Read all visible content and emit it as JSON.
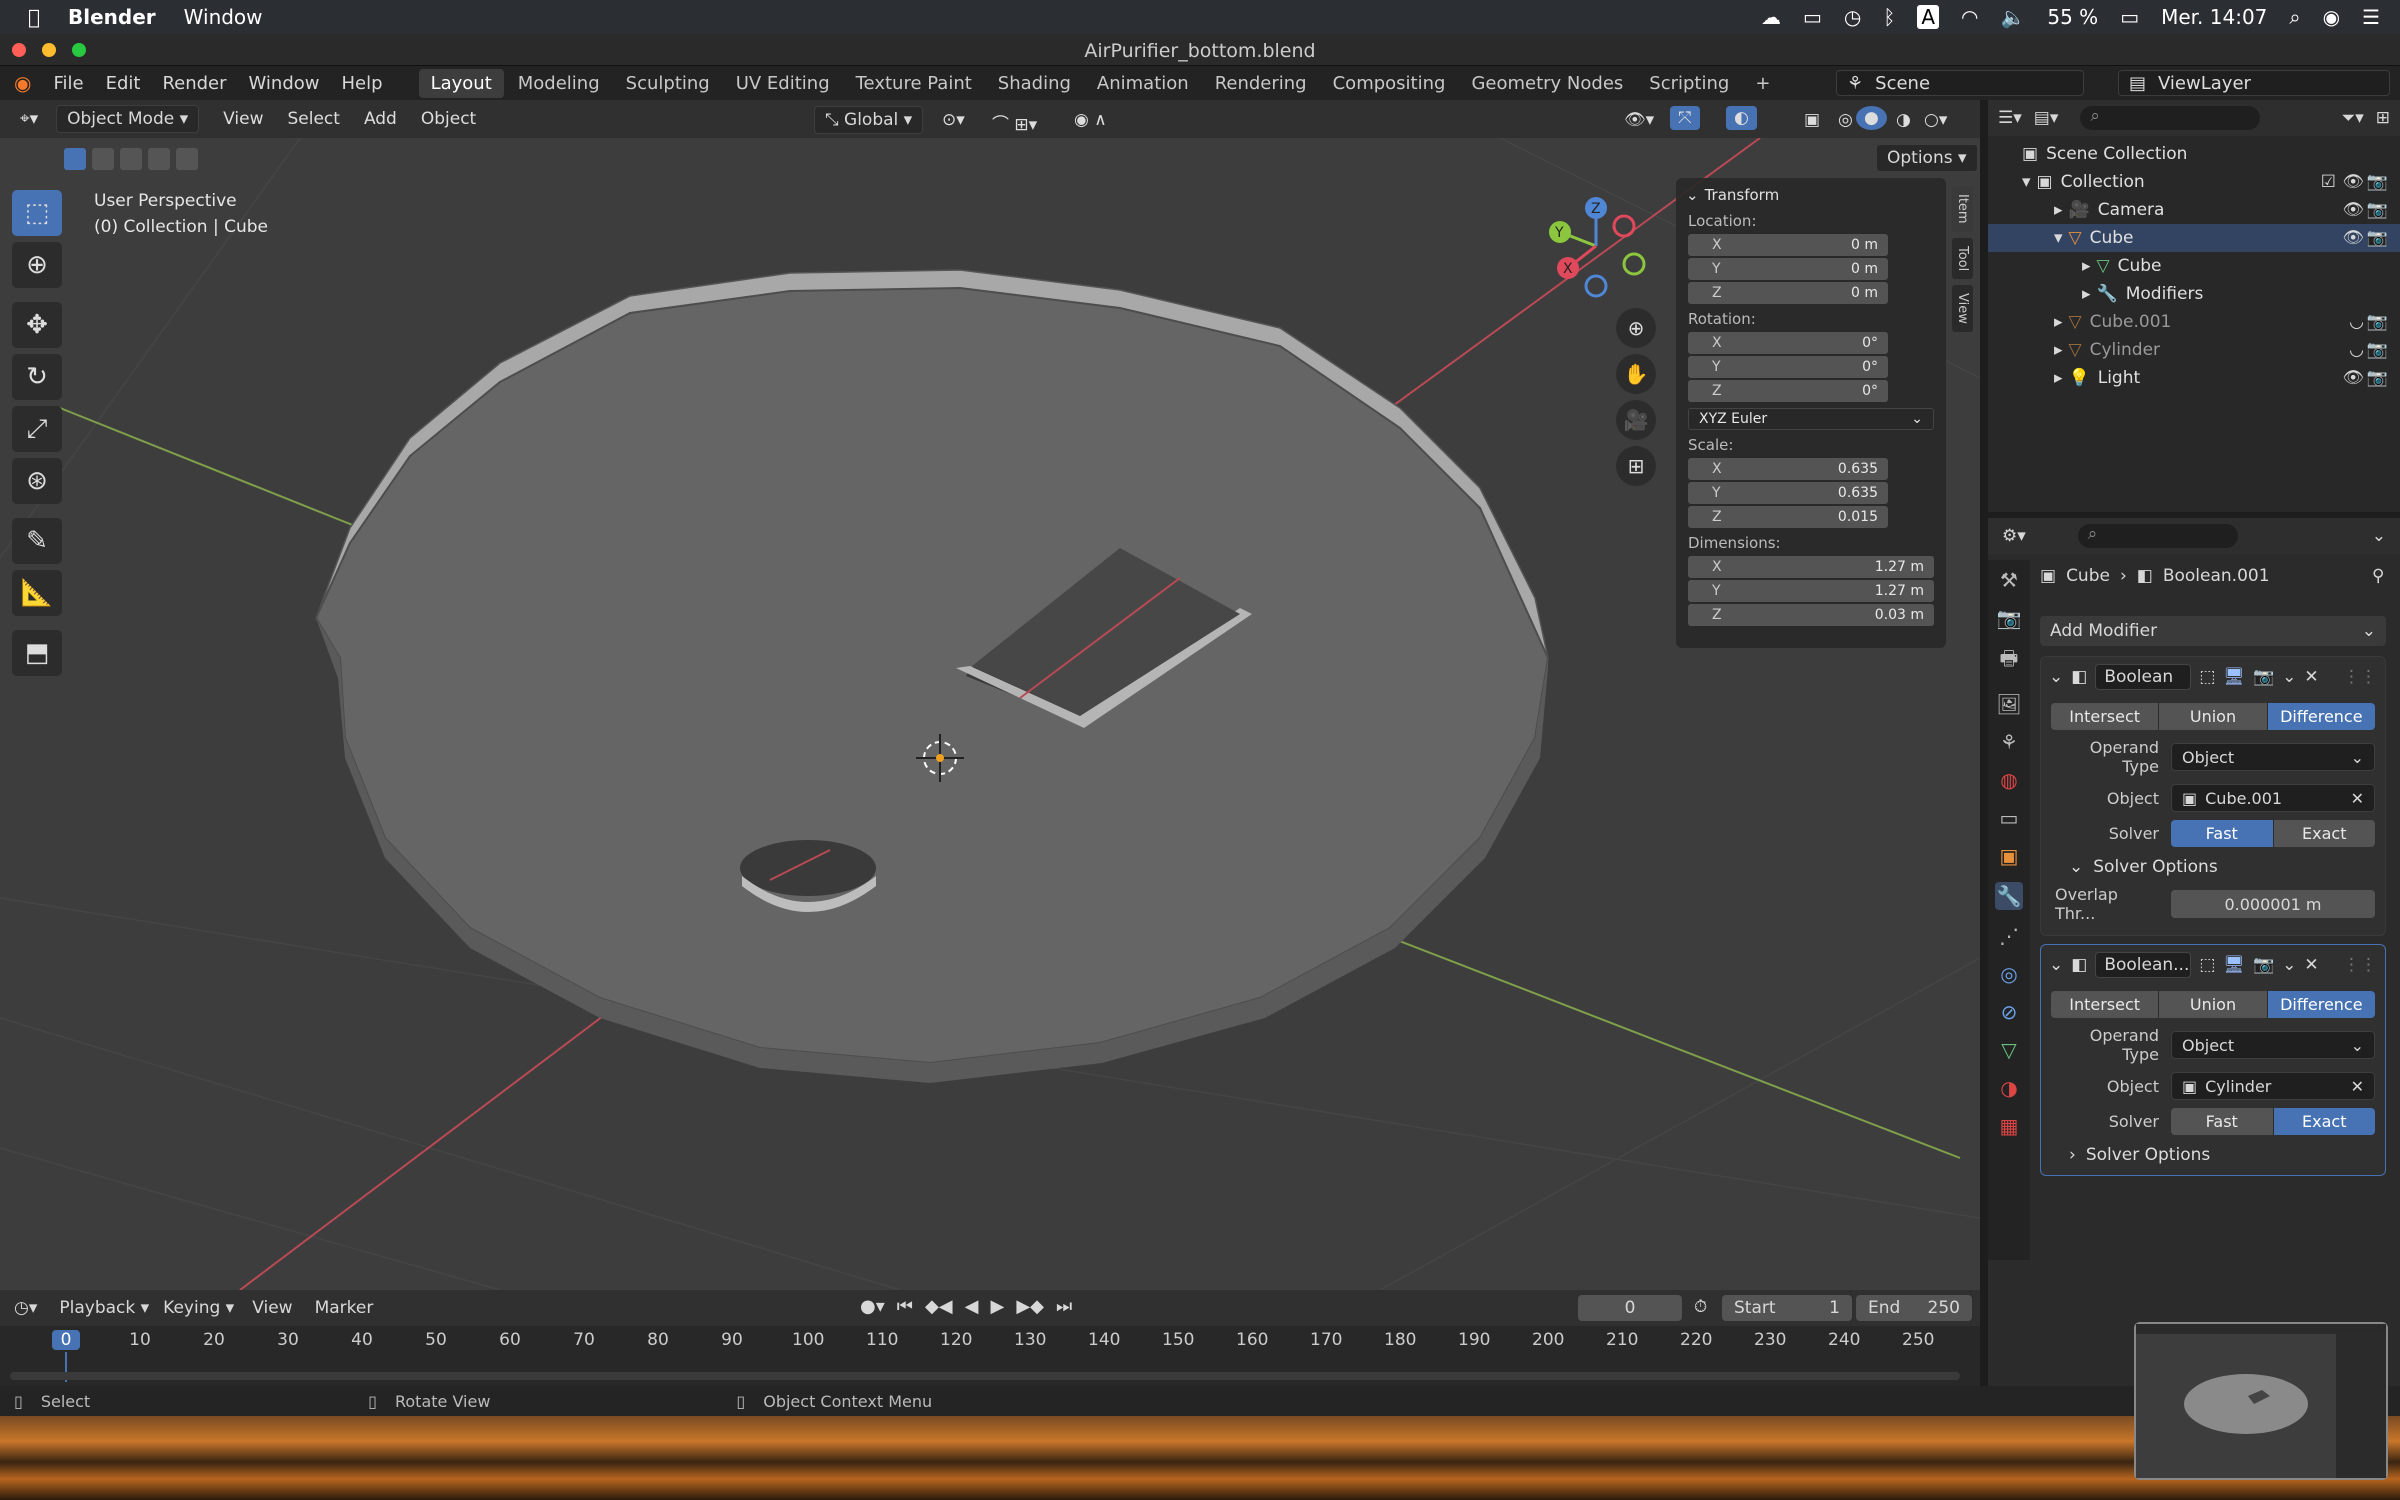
{
  "macos": {
    "app_name": "Blender",
    "menu_window": "Window",
    "battery": "55 %",
    "clock": "Mer. 14:07"
  },
  "window": {
    "title": "AirPurifier_bottom.blend"
  },
  "topbar": {
    "menus": [
      "File",
      "Edit",
      "Render",
      "Window",
      "Help"
    ],
    "workspaces": [
      "Layout",
      "Modeling",
      "Sculpting",
      "UV Editing",
      "Texture Paint",
      "Shading",
      "Animation",
      "Rendering",
      "Compositing",
      "Geometry Nodes",
      "Scripting"
    ],
    "scene": "Scene",
    "view_layer": "ViewLayer"
  },
  "viewport_header": {
    "mode": "Object Mode",
    "menus": [
      "View",
      "Select",
      "Add",
      "Object"
    ],
    "transform_orientation": "Global",
    "options": "Options"
  },
  "viewport": {
    "perspective": "User Perspective",
    "context": "(0) Collection | Cube"
  },
  "npanel": {
    "section": "Transform",
    "location_label": "Location:",
    "location": [
      {
        "axis": "X",
        "value": "0 m"
      },
      {
        "axis": "Y",
        "value": "0 m"
      },
      {
        "axis": "Z",
        "value": "0 m"
      }
    ],
    "rotation_label": "Rotation:",
    "rotation": [
      {
        "axis": "X",
        "value": "0°"
      },
      {
        "axis": "Y",
        "value": "0°"
      },
      {
        "axis": "Z",
        "value": "0°"
      }
    ],
    "rotation_mode": "XYZ Euler",
    "scale_label": "Scale:",
    "scale": [
      {
        "axis": "X",
        "value": "0.635"
      },
      {
        "axis": "Y",
        "value": "0.635"
      },
      {
        "axis": "Z",
        "value": "0.015"
      }
    ],
    "dimensions_label": "Dimensions:",
    "dimensions": [
      {
        "axis": "X",
        "value": "1.27 m"
      },
      {
        "axis": "Y",
        "value": "1.27 m"
      },
      {
        "axis": "Z",
        "value": "0.03 m"
      }
    ],
    "tabs": [
      "Item",
      "Tool",
      "View"
    ]
  },
  "outliner": {
    "root": "Scene Collection",
    "collection": "Collection",
    "items": [
      {
        "name": "Camera",
        "dim": false
      },
      {
        "name": "Cube",
        "dim": false
      },
      {
        "name": "Cube",
        "dim": false
      },
      {
        "name": "Modifiers",
        "dim": false
      },
      {
        "name": "Cube.001",
        "dim": true
      },
      {
        "name": "Cylinder",
        "dim": true
      },
      {
        "name": "Light",
        "dim": false
      }
    ]
  },
  "properties": {
    "breadcrumb_object": "Cube",
    "breadcrumb_modifier": "Boolean.001",
    "add_modifier": "Add Modifier",
    "modifiers": [
      {
        "name": "Boolean",
        "operations": [
          "Intersect",
          "Union",
          "Difference"
        ],
        "active_op": "Difference",
        "operand_label": "Operand Type",
        "operand": "Object",
        "object_label": "Object",
        "object": "Cube.001",
        "solver_label": "Solver",
        "solvers": [
          "Fast",
          "Exact"
        ],
        "active_solver": "Fast",
        "solver_options": "Solver Options",
        "overlap_label": "Overlap Thr...",
        "overlap": "0.000001 m"
      },
      {
        "name": "Boolean...",
        "operations": [
          "Intersect",
          "Union",
          "Difference"
        ],
        "active_op": "Difference",
        "operand_label": "Operand Type",
        "operand": "Object",
        "object_label": "Object",
        "object": "Cylinder",
        "solver_label": "Solver",
        "solvers": [
          "Fast",
          "Exact"
        ],
        "active_solver": "Exact",
        "solver_options": "Solver Options"
      }
    ]
  },
  "timeline": {
    "menus": [
      "Playback",
      "Keying",
      "View",
      "Marker"
    ],
    "current_frame": "0",
    "start_label": "Start",
    "start": "1",
    "end_label": "End",
    "end": "250",
    "ticks": [
      "0",
      "10",
      "20",
      "30",
      "40",
      "50",
      "60",
      "70",
      "80",
      "90",
      "100",
      "110",
      "120",
      "130",
      "140",
      "150",
      "160",
      "170",
      "180",
      "190",
      "200",
      "210",
      "220",
      "230",
      "240",
      "250"
    ]
  },
  "statusbar": {
    "select": "Select",
    "rotate": "Rotate View",
    "context_menu": "Object Context Menu"
  },
  "colors": {
    "accent": "#4772b3",
    "x_axis": "#e0485b",
    "y_axis": "#8cc63f",
    "z_axis": "#4f87d6"
  }
}
